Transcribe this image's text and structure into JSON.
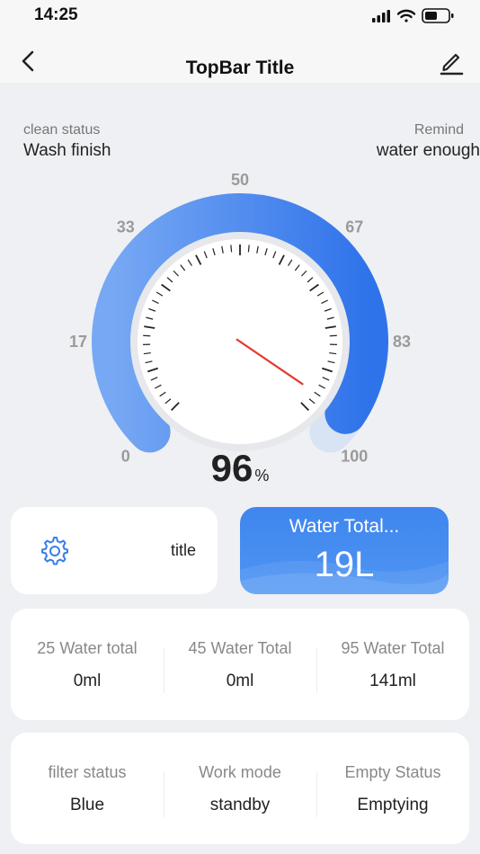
{
  "status_bar": {
    "time": "14:25"
  },
  "top_bar": {
    "title": "TopBar Title"
  },
  "info": {
    "left": {
      "label": "clean status",
      "value": "Wash finish"
    },
    "right": {
      "label": "Remind",
      "value": "water enough"
    }
  },
  "gauge": {
    "tick_labels": [
      "0",
      "17",
      "33",
      "50",
      "67",
      "83",
      "100"
    ],
    "value": 96,
    "value_text": "96",
    "unit": "%",
    "track_color": "#4a8cf0",
    "needle_color": "#e23b2e"
  },
  "settings_card": {
    "icon": "gear-icon",
    "title": "title"
  },
  "water_card": {
    "label": "Water Total...",
    "value": "19L"
  },
  "stats_row1": [
    {
      "label": "25 Water total",
      "value": "0ml"
    },
    {
      "label": "45 Water Total",
      "value": "0ml"
    },
    {
      "label": "95 Water Total",
      "value": "141ml"
    }
  ],
  "stats_row2": [
    {
      "label": "filter status",
      "value": "Blue"
    },
    {
      "label": "Work mode",
      "value": "standby"
    },
    {
      "label": "Empty Status",
      "value": "Emptying"
    }
  ]
}
